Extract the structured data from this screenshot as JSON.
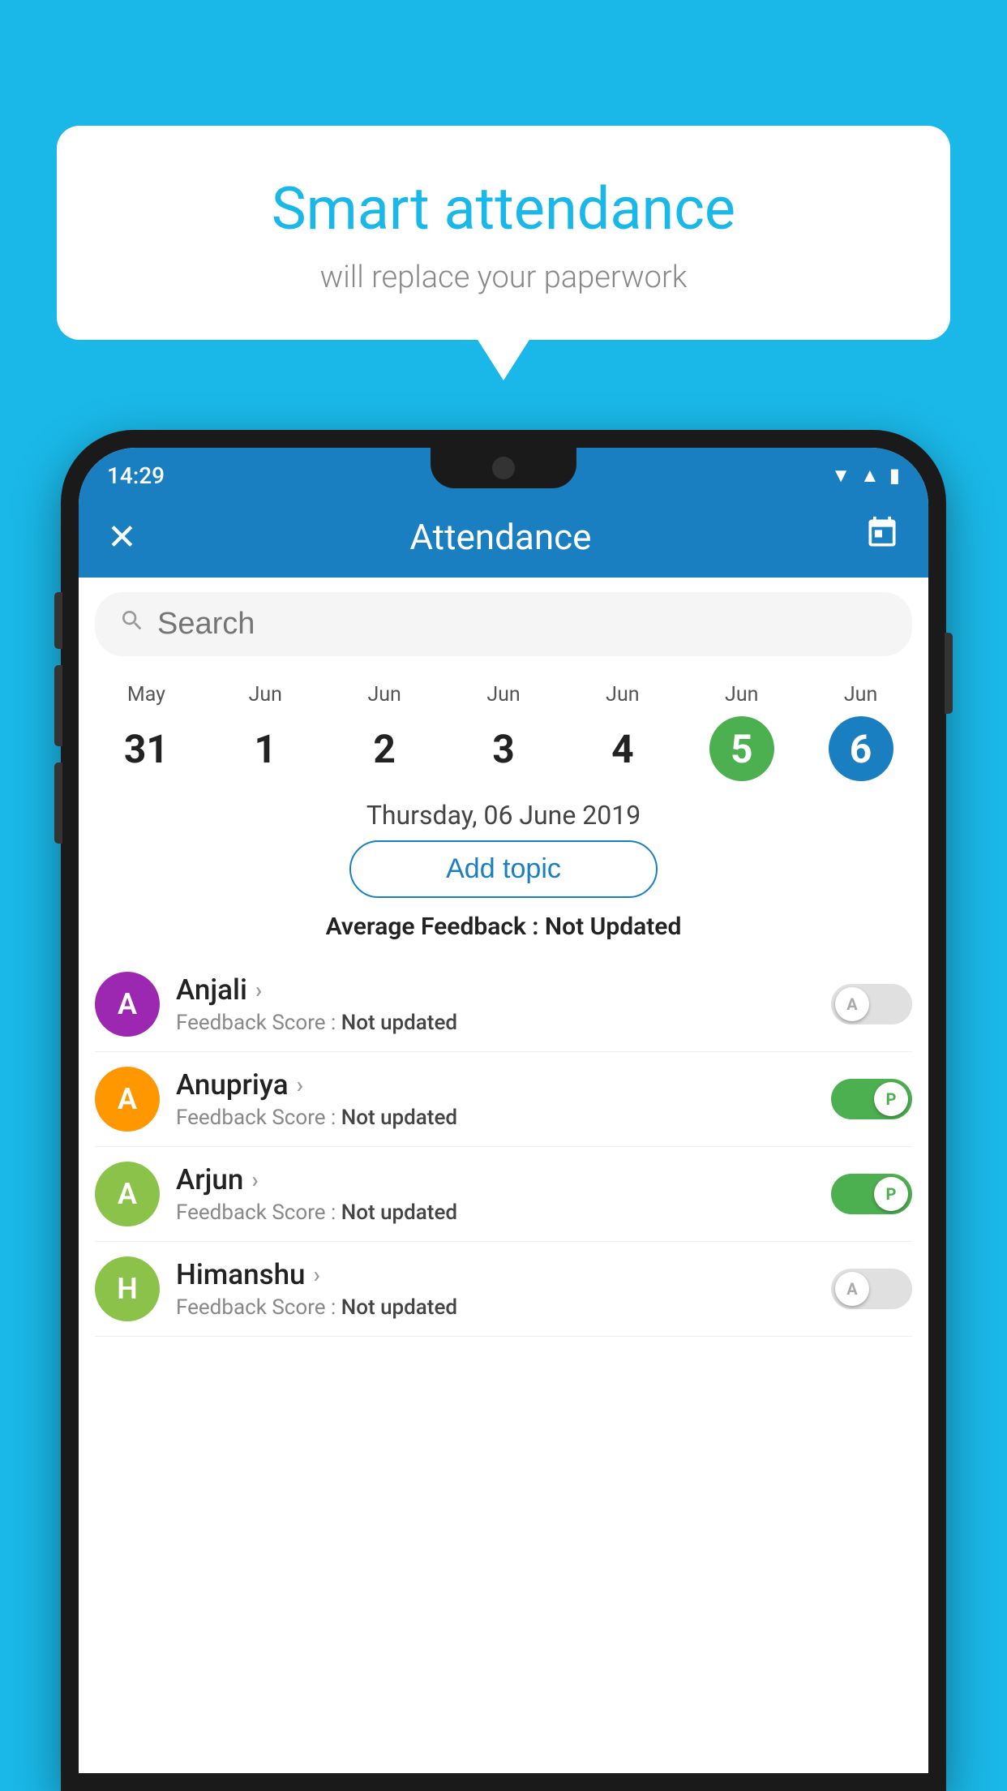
{
  "background_color": "#1ab8e8",
  "speech_bubble": {
    "title": "Smart attendance",
    "subtitle": "will replace your paperwork"
  },
  "status_bar": {
    "time": "14:29",
    "wifi_icon": "▲",
    "signal_icon": "◀",
    "battery_icon": "▮"
  },
  "app_bar": {
    "close_icon": "✕",
    "title": "Attendance",
    "calendar_icon": "📅"
  },
  "search": {
    "placeholder": "Search",
    "icon": "🔍"
  },
  "calendar": {
    "days": [
      {
        "month": "May",
        "date": "31",
        "style": "normal"
      },
      {
        "month": "Jun",
        "date": "1",
        "style": "normal"
      },
      {
        "month": "Jun",
        "date": "2",
        "style": "normal"
      },
      {
        "month": "Jun",
        "date": "3",
        "style": "normal"
      },
      {
        "month": "Jun",
        "date": "4",
        "style": "normal"
      },
      {
        "month": "Jun",
        "date": "5",
        "style": "green"
      },
      {
        "month": "Jun",
        "date": "6",
        "style": "blue"
      }
    ],
    "selected_date": "Thursday, 06 June 2019"
  },
  "add_topic_button": "Add topic",
  "avg_feedback": {
    "label": "Average Feedback : ",
    "value": "Not Updated"
  },
  "students": [
    {
      "name": "Anjali",
      "avatar_letter": "A",
      "avatar_color": "#9c27b0",
      "feedback_label": "Feedback Score : ",
      "feedback_value": "Not updated",
      "toggle": "off",
      "toggle_letter": "A"
    },
    {
      "name": "Anupriya",
      "avatar_letter": "A",
      "avatar_color": "#ff9800",
      "feedback_label": "Feedback Score : ",
      "feedback_value": "Not updated",
      "toggle": "on",
      "toggle_letter": "P"
    },
    {
      "name": "Arjun",
      "avatar_letter": "A",
      "avatar_color": "#8bc34a",
      "feedback_label": "Feedback Score : ",
      "feedback_value": "Not updated",
      "toggle": "on",
      "toggle_letter": "P"
    },
    {
      "name": "Himanshu",
      "avatar_letter": "H",
      "avatar_color": "#8bc34a",
      "feedback_label": "Feedback Score : ",
      "feedback_value": "Not updated",
      "toggle": "off",
      "toggle_letter": "A"
    }
  ]
}
